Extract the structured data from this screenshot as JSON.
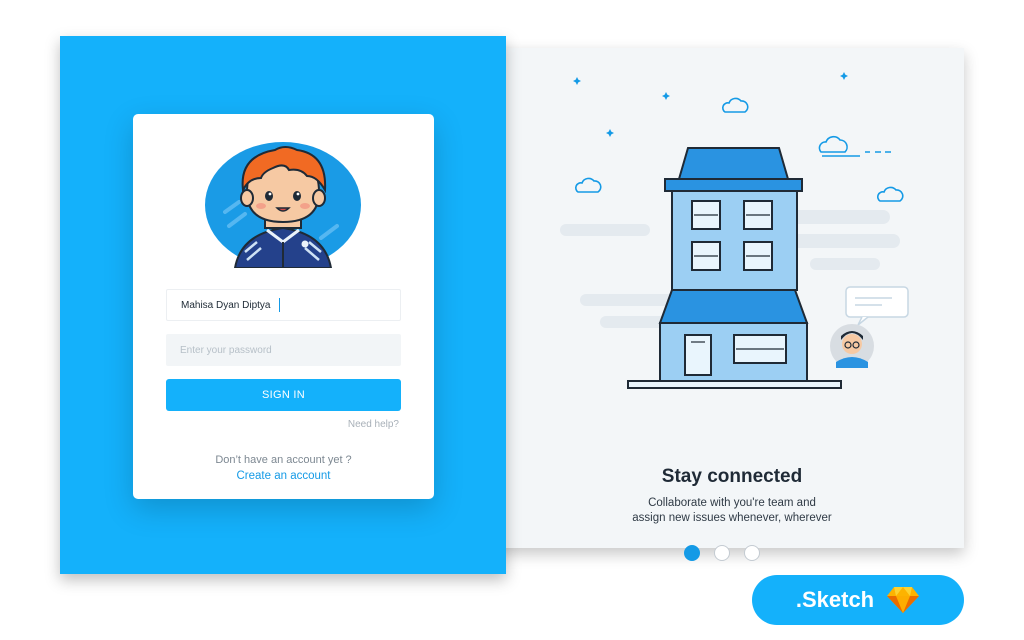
{
  "login": {
    "username_value": "Mahisa Dyan Diptya",
    "password_placeholder": "Enter your password",
    "signin_label": "SIGN IN",
    "need_help": "Need help?",
    "no_account": "Don’t have an account yet ?",
    "create_account": "Create an account"
  },
  "onboarding": {
    "title": "Stay connected",
    "description_line1": "Collaborate with you're team and",
    "description_line2": "assign new issues whenever, wherever",
    "pagination": {
      "total": 3,
      "active": 1
    }
  },
  "badge": {
    "label": ".Sketch",
    "icon": "sketch-diamond-icon"
  },
  "colors": {
    "brand_blue": "#14b1fb",
    "accent_blue": "#149ae6",
    "dark_text": "#1f2a36"
  },
  "icons": [
    "avatar-boy-icon",
    "building-illustration",
    "cloud-icon",
    "sparkle-icon",
    "chat-bubble-icon",
    "man-avatar-icon",
    "sketch-diamond-icon"
  ]
}
